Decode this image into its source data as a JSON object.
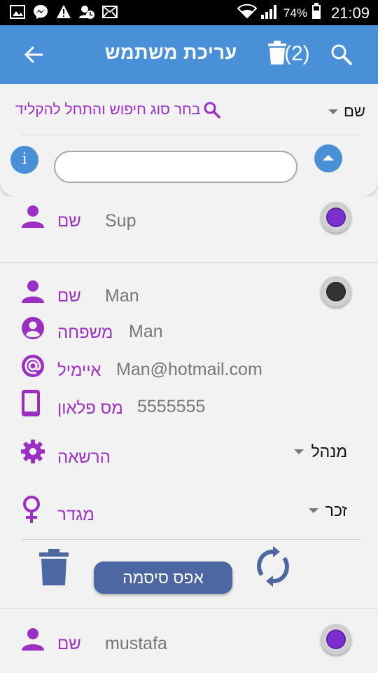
{
  "status_bar": {
    "battery_percent": "74%",
    "time": "21:09"
  },
  "app_bar": {
    "title": "עריכת משתמש",
    "selected_count": "(2)"
  },
  "search": {
    "type_selected": "שם",
    "hint": "בחר סוג חיפוש והתחל להקליד",
    "input_value": "",
    "info_label": "i"
  },
  "users": [
    {
      "name_label": "שם",
      "name": "Sup",
      "selected_color": "#7b2fd0"
    },
    {
      "name_label": "שם",
      "name": "Man",
      "last_name_label": "משפחה",
      "last_name": "Man",
      "email_label": "איימיל",
      "email": "Man@hotmail.com",
      "phone_label": "מס פלאון",
      "phone": "5555555",
      "permission_label": "הרשאה",
      "permission_value": "מנהל",
      "gender_label": "מגדר",
      "gender_value": "זכר",
      "reset_password_label": "אפס סיסמה",
      "selected_color": "#333333"
    },
    {
      "name_label": "שם",
      "name": "mustafa",
      "selected_color": "#7b2fd0"
    }
  ],
  "colors": {
    "primary": "#4a90d9",
    "accent_purple": "#9b2fc4",
    "button_blue": "#4d67a3"
  }
}
